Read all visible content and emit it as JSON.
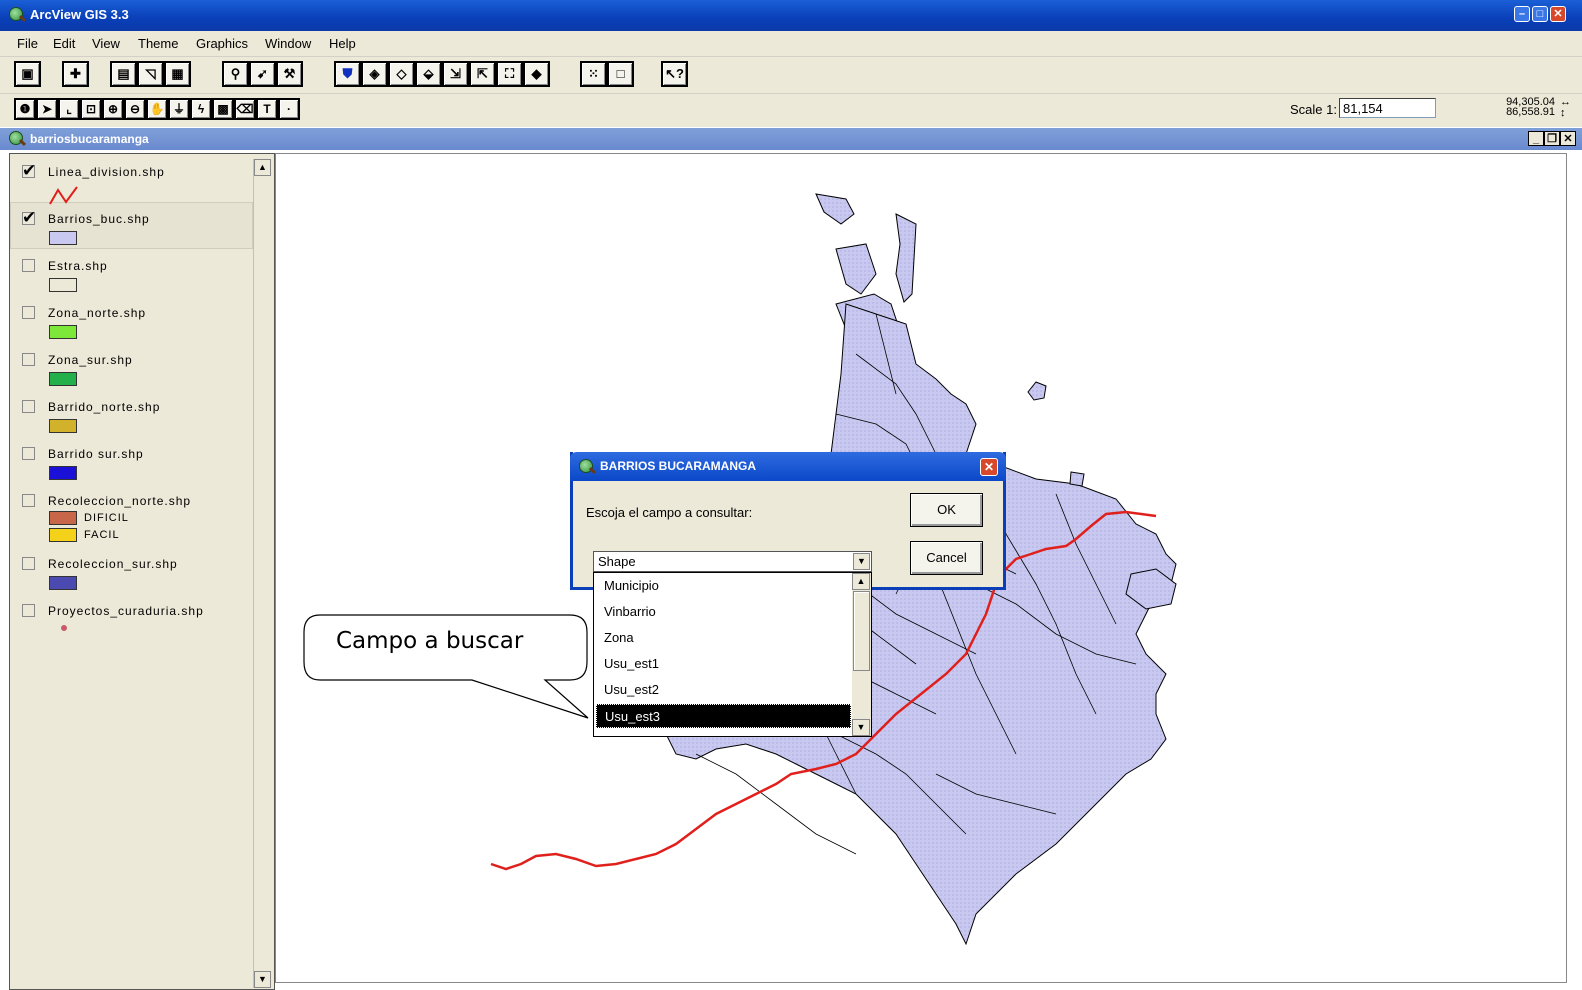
{
  "app": {
    "title": "ArcView GIS 3.3"
  },
  "menus": [
    {
      "label": "File"
    },
    {
      "label": "Edit"
    },
    {
      "label": "View"
    },
    {
      "label": "Theme"
    },
    {
      "label": "Graphics"
    },
    {
      "label": "Window"
    },
    {
      "label": "Help"
    }
  ],
  "toolbar": {
    "scale_label": "Scale 1:",
    "scale_value": "81,154",
    "coord_x": "94,305.04",
    "coord_y": "86,558.91"
  },
  "view_window": {
    "title": "barriosbucaramanga"
  },
  "layers": [
    {
      "name": "Linea_division.shp",
      "checked": true,
      "symbol": "line",
      "color": "#e0201c"
    },
    {
      "name": "Barrios_buc.shp",
      "checked": true,
      "symbol": "fill",
      "color": "#c8c8f0"
    },
    {
      "name": "Estra.shp",
      "checked": false,
      "symbol": "fill",
      "color": "#ece9d8"
    },
    {
      "name": "Zona_norte.shp",
      "checked": false,
      "symbol": "fill",
      "color": "#7ee83a"
    },
    {
      "name": "Zona_sur.shp",
      "checked": false,
      "symbol": "fill",
      "color": "#23b04a"
    },
    {
      "name": "Barrido_norte.shp",
      "checked": false,
      "symbol": "fill",
      "color": "#d2b22a"
    },
    {
      "name": "Barrido sur.shp",
      "checked": false,
      "symbol": "fill",
      "color": "#1a10d8"
    },
    {
      "name": "Recoleccion_norte.shp",
      "checked": false,
      "symbol": "classes",
      "classes": [
        {
          "label": "DIFICIL",
          "color": "#c8664a"
        },
        {
          "label": "FACIL",
          "color": "#f4d21a"
        }
      ]
    },
    {
      "name": "Recoleccion_sur.shp",
      "checked": false,
      "symbol": "fill",
      "color": "#4a4ab0"
    },
    {
      "name": "Proyectos_curaduria.shp",
      "checked": false,
      "symbol": "point",
      "color": "#c85a6a"
    }
  ],
  "dialog": {
    "title": "BARRIOS BUCARAMANGA",
    "prompt": "Escoja el campo a consultar:",
    "ok_label": "OK",
    "cancel_label": "Cancel",
    "selected_field": "Shape",
    "options": [
      "Municipio",
      "Vinbarrio",
      "Zona",
      "Usu_est1",
      "Usu_est2",
      "Usu_est3"
    ],
    "highlighted_option": "Usu_est3"
  },
  "callout": {
    "text": "Campo a buscar"
  },
  "colors": {
    "map_fill": "#c8c8f0",
    "division_line": "#e0201c",
    "title_blue": "#0a3fb8"
  }
}
